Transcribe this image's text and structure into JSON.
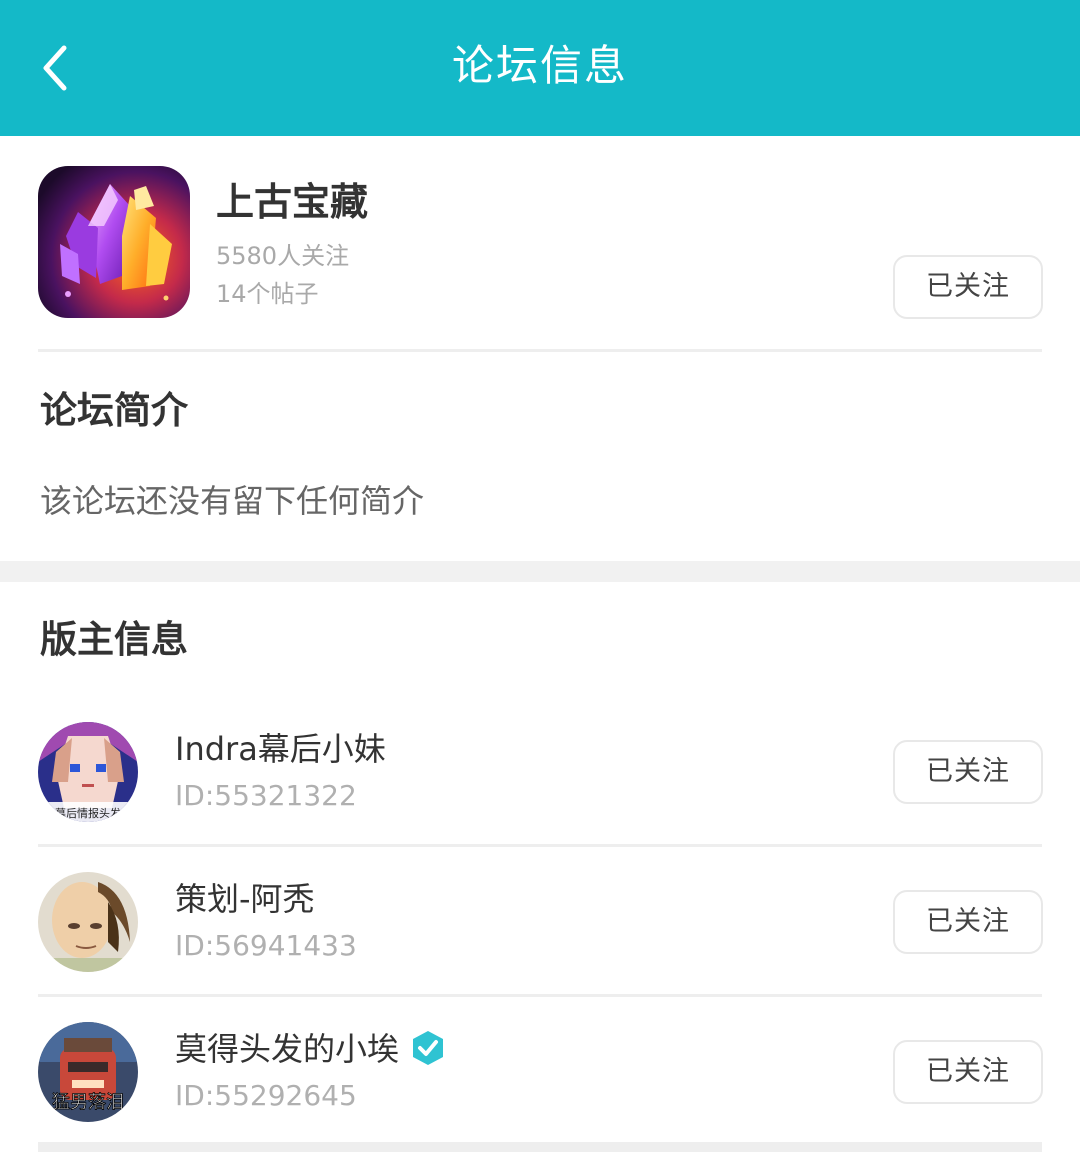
{
  "header": {
    "title": "论坛信息",
    "back_icon": "chevron-left-icon"
  },
  "forum": {
    "name": "上古宝藏",
    "followers": "5580人关注",
    "posts": "14个帖子",
    "follow_label": "已关注"
  },
  "intro": {
    "title": "论坛简介",
    "text": "该论坛还没有留下任何简介"
  },
  "moderators": {
    "title": "版主信息",
    "items": [
      {
        "name": "Indra幕后小妹",
        "id": "ID:55321322",
        "follow_label": "已关注",
        "verified": false,
        "avatar_caption": "幕后情报头发"
      },
      {
        "name": "策划-阿秃",
        "id": "ID:56941433",
        "follow_label": "已关注",
        "verified": false
      },
      {
        "name": "莫得头发的小埃",
        "id": "ID:55292645",
        "follow_label": "已关注",
        "verified": true,
        "avatar_caption": "猛男落泪"
      }
    ]
  },
  "colors": {
    "accent": "#14b9c8",
    "verified": "#2fc3d2"
  }
}
